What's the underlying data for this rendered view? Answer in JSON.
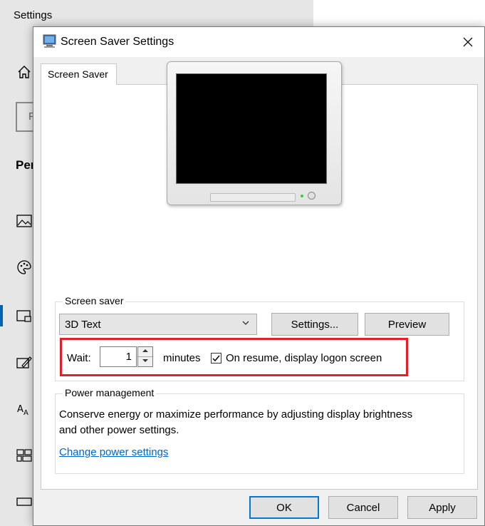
{
  "background_app": {
    "title": "Settings",
    "search_text": "F",
    "section_heading": "Per"
  },
  "dialog": {
    "title": "Screen Saver Settings",
    "close_label": "✕",
    "tab_label": "Screen Saver",
    "screen_saver_group": {
      "label": "Screen saver",
      "selected_saver": "3D Text",
      "settings_button": "Settings...",
      "preview_button": "Preview",
      "wait_label": "Wait:",
      "wait_value": "1",
      "minutes_label": "minutes",
      "on_resume_checked": true,
      "on_resume_label": "On resume, display logon screen"
    },
    "power_group": {
      "label": "Power management",
      "description": "Conserve energy or maximize performance by adjusting display brightness and other power settings.",
      "link": "Change power settings"
    },
    "buttons": {
      "ok": "OK",
      "cancel": "Cancel",
      "apply": "Apply"
    }
  },
  "colors": {
    "highlight": "#e0202a",
    "link": "#0066cc",
    "accent": "#0063b1"
  }
}
